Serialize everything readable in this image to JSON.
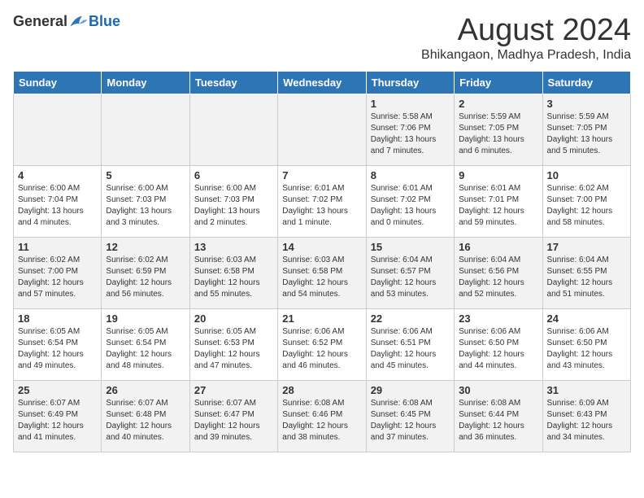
{
  "header": {
    "logo_general": "General",
    "logo_blue": "Blue",
    "month_title": "August 2024",
    "location": "Bhikangaon, Madhya Pradesh, India"
  },
  "days_of_week": [
    "Sunday",
    "Monday",
    "Tuesday",
    "Wednesday",
    "Thursday",
    "Friday",
    "Saturday"
  ],
  "weeks": [
    [
      {
        "day": "",
        "info": ""
      },
      {
        "day": "",
        "info": ""
      },
      {
        "day": "",
        "info": ""
      },
      {
        "day": "",
        "info": ""
      },
      {
        "day": "1",
        "info": "Sunrise: 5:58 AM\nSunset: 7:06 PM\nDaylight: 13 hours and 7 minutes."
      },
      {
        "day": "2",
        "info": "Sunrise: 5:59 AM\nSunset: 7:05 PM\nDaylight: 13 hours and 6 minutes."
      },
      {
        "day": "3",
        "info": "Sunrise: 5:59 AM\nSunset: 7:05 PM\nDaylight: 13 hours and 5 minutes."
      }
    ],
    [
      {
        "day": "4",
        "info": "Sunrise: 6:00 AM\nSunset: 7:04 PM\nDaylight: 13 hours and 4 minutes."
      },
      {
        "day": "5",
        "info": "Sunrise: 6:00 AM\nSunset: 7:03 PM\nDaylight: 13 hours and 3 minutes."
      },
      {
        "day": "6",
        "info": "Sunrise: 6:00 AM\nSunset: 7:03 PM\nDaylight: 13 hours and 2 minutes."
      },
      {
        "day": "7",
        "info": "Sunrise: 6:01 AM\nSunset: 7:02 PM\nDaylight: 13 hours and 1 minute."
      },
      {
        "day": "8",
        "info": "Sunrise: 6:01 AM\nSunset: 7:02 PM\nDaylight: 13 hours and 0 minutes."
      },
      {
        "day": "9",
        "info": "Sunrise: 6:01 AM\nSunset: 7:01 PM\nDaylight: 12 hours and 59 minutes."
      },
      {
        "day": "10",
        "info": "Sunrise: 6:02 AM\nSunset: 7:00 PM\nDaylight: 12 hours and 58 minutes."
      }
    ],
    [
      {
        "day": "11",
        "info": "Sunrise: 6:02 AM\nSunset: 7:00 PM\nDaylight: 12 hours and 57 minutes."
      },
      {
        "day": "12",
        "info": "Sunrise: 6:02 AM\nSunset: 6:59 PM\nDaylight: 12 hours and 56 minutes."
      },
      {
        "day": "13",
        "info": "Sunrise: 6:03 AM\nSunset: 6:58 PM\nDaylight: 12 hours and 55 minutes."
      },
      {
        "day": "14",
        "info": "Sunrise: 6:03 AM\nSunset: 6:58 PM\nDaylight: 12 hours and 54 minutes."
      },
      {
        "day": "15",
        "info": "Sunrise: 6:04 AM\nSunset: 6:57 PM\nDaylight: 12 hours and 53 minutes."
      },
      {
        "day": "16",
        "info": "Sunrise: 6:04 AM\nSunset: 6:56 PM\nDaylight: 12 hours and 52 minutes."
      },
      {
        "day": "17",
        "info": "Sunrise: 6:04 AM\nSunset: 6:55 PM\nDaylight: 12 hours and 51 minutes."
      }
    ],
    [
      {
        "day": "18",
        "info": "Sunrise: 6:05 AM\nSunset: 6:54 PM\nDaylight: 12 hours and 49 minutes."
      },
      {
        "day": "19",
        "info": "Sunrise: 6:05 AM\nSunset: 6:54 PM\nDaylight: 12 hours and 48 minutes."
      },
      {
        "day": "20",
        "info": "Sunrise: 6:05 AM\nSunset: 6:53 PM\nDaylight: 12 hours and 47 minutes."
      },
      {
        "day": "21",
        "info": "Sunrise: 6:06 AM\nSunset: 6:52 PM\nDaylight: 12 hours and 46 minutes."
      },
      {
        "day": "22",
        "info": "Sunrise: 6:06 AM\nSunset: 6:51 PM\nDaylight: 12 hours and 45 minutes."
      },
      {
        "day": "23",
        "info": "Sunrise: 6:06 AM\nSunset: 6:50 PM\nDaylight: 12 hours and 44 minutes."
      },
      {
        "day": "24",
        "info": "Sunrise: 6:06 AM\nSunset: 6:50 PM\nDaylight: 12 hours and 43 minutes."
      }
    ],
    [
      {
        "day": "25",
        "info": "Sunrise: 6:07 AM\nSunset: 6:49 PM\nDaylight: 12 hours and 41 minutes."
      },
      {
        "day": "26",
        "info": "Sunrise: 6:07 AM\nSunset: 6:48 PM\nDaylight: 12 hours and 40 minutes."
      },
      {
        "day": "27",
        "info": "Sunrise: 6:07 AM\nSunset: 6:47 PM\nDaylight: 12 hours and 39 minutes."
      },
      {
        "day": "28",
        "info": "Sunrise: 6:08 AM\nSunset: 6:46 PM\nDaylight: 12 hours and 38 minutes."
      },
      {
        "day": "29",
        "info": "Sunrise: 6:08 AM\nSunset: 6:45 PM\nDaylight: 12 hours and 37 minutes."
      },
      {
        "day": "30",
        "info": "Sunrise: 6:08 AM\nSunset: 6:44 PM\nDaylight: 12 hours and 36 minutes."
      },
      {
        "day": "31",
        "info": "Sunrise: 6:09 AM\nSunset: 6:43 PM\nDaylight: 12 hours and 34 minutes."
      }
    ]
  ]
}
